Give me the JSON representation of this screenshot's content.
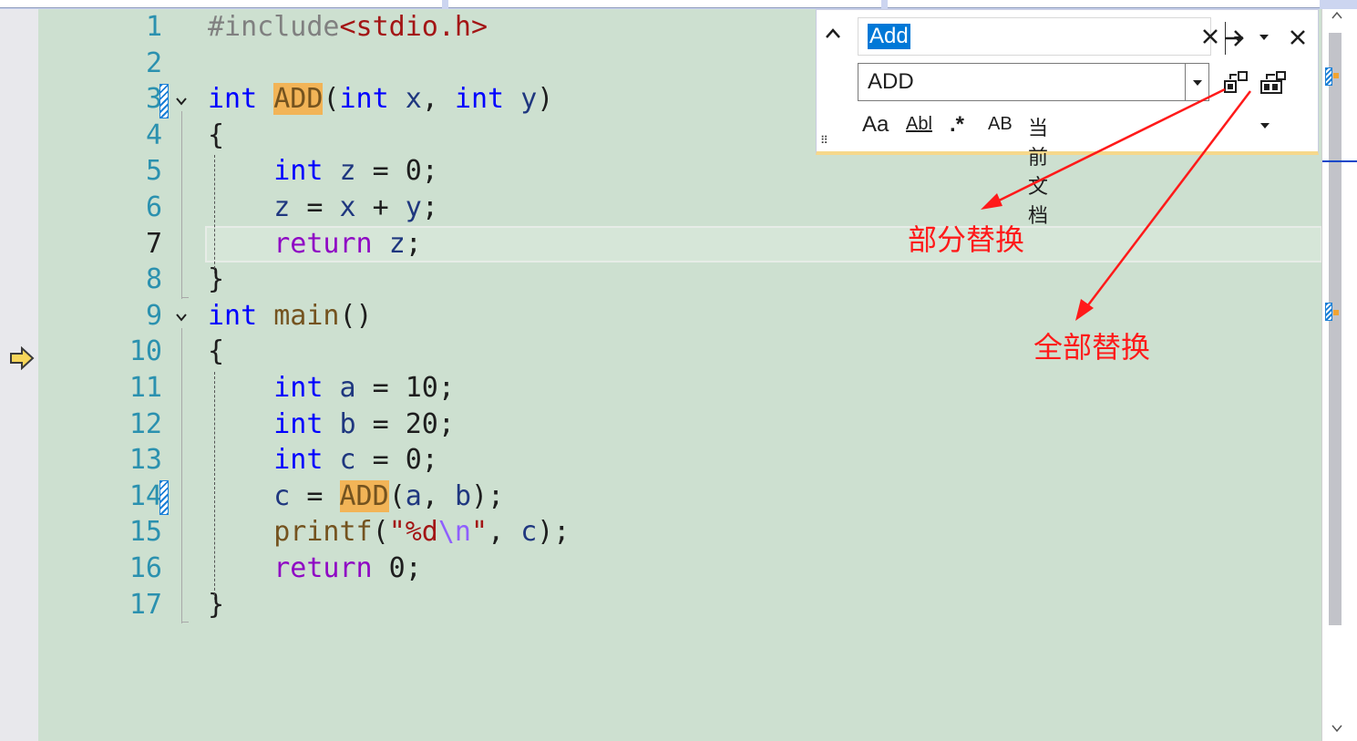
{
  "editor": {
    "lines": [
      {
        "num": "1",
        "tokens": [
          {
            "t": "#include",
            "c": "pp"
          },
          {
            "t": "<stdio.h>",
            "c": "str"
          }
        ]
      },
      {
        "num": "2",
        "tokens": []
      },
      {
        "num": "3",
        "tokens": [
          {
            "t": "int",
            "c": "kw"
          },
          {
            "t": " "
          },
          {
            "t": "ADD",
            "c": "fn hl"
          },
          {
            "t": "("
          },
          {
            "t": "int",
            "c": "kw"
          },
          {
            "t": " "
          },
          {
            "t": "x",
            "c": "var"
          },
          {
            "t": ", "
          },
          {
            "t": "int",
            "c": "kw"
          },
          {
            "t": " "
          },
          {
            "t": "y",
            "c": "var"
          },
          {
            "t": ")"
          }
        ]
      },
      {
        "num": "4",
        "tokens": [
          {
            "t": "{"
          }
        ]
      },
      {
        "num": "5",
        "tokens": [
          {
            "t": "    "
          },
          {
            "t": "int",
            "c": "kw"
          },
          {
            "t": " "
          },
          {
            "t": "z",
            "c": "var"
          },
          {
            "t": " = 0;"
          }
        ]
      },
      {
        "num": "6",
        "tokens": [
          {
            "t": "    "
          },
          {
            "t": "z",
            "c": "var"
          },
          {
            "t": " = "
          },
          {
            "t": "x",
            "c": "var"
          },
          {
            "t": " + "
          },
          {
            "t": "y",
            "c": "var"
          },
          {
            "t": ";"
          }
        ]
      },
      {
        "num": "7",
        "tokens": [
          {
            "t": "    "
          },
          {
            "t": "return",
            "c": "ctl"
          },
          {
            "t": " "
          },
          {
            "t": "z",
            "c": "var"
          },
          {
            "t": ";"
          }
        ]
      },
      {
        "num": "8",
        "tokens": [
          {
            "t": "}"
          }
        ]
      },
      {
        "num": "9",
        "tokens": [
          {
            "t": "int",
            "c": "kw"
          },
          {
            "t": " "
          },
          {
            "t": "main",
            "c": "fn"
          },
          {
            "t": "()"
          }
        ]
      },
      {
        "num": "10",
        "tokens": [
          {
            "t": "{"
          }
        ]
      },
      {
        "num": "11",
        "tokens": [
          {
            "t": "    "
          },
          {
            "t": "int",
            "c": "kw"
          },
          {
            "t": " "
          },
          {
            "t": "a",
            "c": "var"
          },
          {
            "t": " = 10;"
          }
        ]
      },
      {
        "num": "12",
        "tokens": [
          {
            "t": "    "
          },
          {
            "t": "int",
            "c": "kw"
          },
          {
            "t": " "
          },
          {
            "t": "b",
            "c": "var"
          },
          {
            "t": " = 20;"
          }
        ]
      },
      {
        "num": "13",
        "tokens": [
          {
            "t": "    "
          },
          {
            "t": "int",
            "c": "kw"
          },
          {
            "t": " "
          },
          {
            "t": "c",
            "c": "var"
          },
          {
            "t": " = 0;"
          }
        ]
      },
      {
        "num": "14",
        "tokens": [
          {
            "t": "    "
          },
          {
            "t": "c",
            "c": "var"
          },
          {
            "t": " = "
          },
          {
            "t": "ADD",
            "c": "fn hl"
          },
          {
            "t": "("
          },
          {
            "t": "a",
            "c": "var"
          },
          {
            "t": ", "
          },
          {
            "t": "b",
            "c": "var"
          },
          {
            "t": ");"
          }
        ]
      },
      {
        "num": "15",
        "tokens": [
          {
            "t": "    "
          },
          {
            "t": "printf",
            "c": "fn"
          },
          {
            "t": "("
          },
          {
            "t": "\"%d",
            "c": "str"
          },
          {
            "t": "\\n",
            "c": "esc"
          },
          {
            "t": "\"",
            "c": "str"
          },
          {
            "t": ", "
          },
          {
            "t": "c",
            "c": "var"
          },
          {
            "t": ");"
          }
        ]
      },
      {
        "num": "16",
        "tokens": [
          {
            "t": "    "
          },
          {
            "t": "return",
            "c": "ctl"
          },
          {
            "t": " 0;"
          }
        ]
      },
      {
        "num": "17",
        "tokens": [
          {
            "t": "}"
          }
        ]
      }
    ],
    "current_line": "7"
  },
  "find_panel": {
    "search_value": "Add",
    "replace_value": "ADD",
    "options": {
      "match_case": "Aa",
      "whole_word": "Abl",
      "regex": ".*",
      "preserve_case": "AB",
      "scope": "当前文档"
    }
  },
  "annotations": {
    "replace_one": "部分替换",
    "replace_all": "全部替换"
  },
  "colors": {
    "editor_bg": "#cde0d0",
    "annotation": "#ff1a1a",
    "search_highlight": "#f2b457",
    "selection": "#0078d7"
  }
}
